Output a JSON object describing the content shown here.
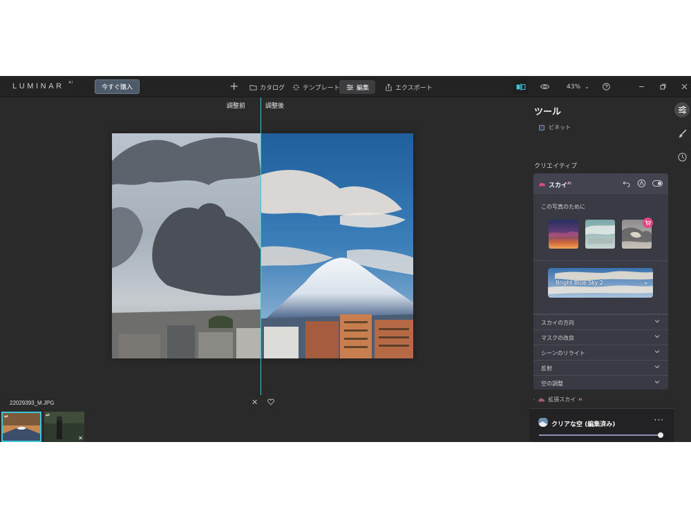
{
  "app": {
    "logo": "LUMINAR",
    "logo_suffix": "AI",
    "buy_label": "今すぐ購入"
  },
  "nav": {
    "add": "+",
    "catalog": "カタログ",
    "templates": "テンプレート",
    "edit": "編集",
    "export": "エクスポート"
  },
  "toolbar": {
    "zoom": "43%",
    "zoom_chevron": "⌄"
  },
  "canvas": {
    "before_label": "調整前",
    "after_label": "調整後",
    "split_fraction": 0.495
  },
  "file": {
    "name": "22029393_M.JPG",
    "close": "✕"
  },
  "filmstrip": {
    "thumb_badge": "⇌",
    "thumb_close": "✕"
  },
  "panel": {
    "title": "ツール",
    "vignette": "ビネット",
    "creative": "クリエイティブ",
    "sky": {
      "name": "スカイ",
      "name_suffix": "AI",
      "for_this_photo": "この写真のために",
      "selected_sky": "Bright Blue Sky 2",
      "accordion": [
        "スカイの方向",
        "マスクの改良",
        "シーンのリライト",
        "反射",
        "空の調整"
      ]
    },
    "extended_sky": "拡張スカイ",
    "extended_sky_suffix": "AI",
    "preset": {
      "name": "クリアな空 (編集済み)",
      "more": "···",
      "amount": 1.0
    }
  },
  "colors": {
    "accent": "#3fc6df",
    "sky_pink": "#e0467f",
    "panel_bg": "#2a2a2b"
  }
}
